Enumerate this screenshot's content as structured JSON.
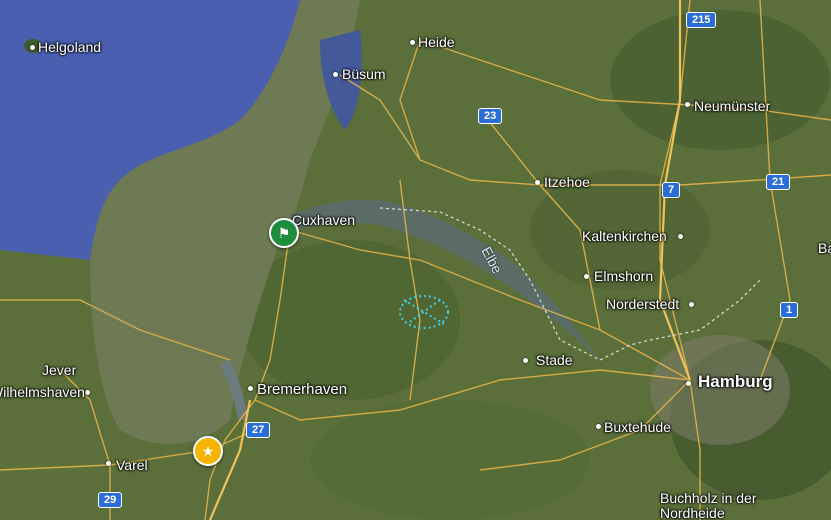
{
  "map": {
    "places": [
      {
        "id": "helgoland",
        "name": "Helgoland"
      },
      {
        "id": "heide",
        "name": "Heide"
      },
      {
        "id": "busum",
        "name": "Büsum"
      },
      {
        "id": "neumunster",
        "name": "Neumünster"
      },
      {
        "id": "itzehoe",
        "name": "Itzehoe"
      },
      {
        "id": "cuxhaven",
        "name": "Cuxhaven"
      },
      {
        "id": "kaltenkirchen",
        "name": "Kaltenkirchen"
      },
      {
        "id": "elmshorn",
        "name": "Elmshorn"
      },
      {
        "id": "norderstedt",
        "name": "Norderstedt"
      },
      {
        "id": "stade",
        "name": "Stade"
      },
      {
        "id": "hamburg",
        "name": "Hamburg"
      },
      {
        "id": "jever",
        "name": "Jever"
      },
      {
        "id": "wilhelmshaven",
        "name": "Wilhelmshaven"
      },
      {
        "id": "bremerhaven",
        "name": "Bremerhaven"
      },
      {
        "id": "buxtehude",
        "name": "Buxtehude"
      },
      {
        "id": "varel",
        "name": "Varel"
      },
      {
        "id": "buchholz",
        "name": "Buchholz in der Nordheide"
      },
      {
        "id": "ba_partial",
        "name": "Ba"
      }
    ],
    "river_label": "Elbe",
    "road_shields": [
      "215",
      "23",
      "7",
      "21",
      "1",
      "27",
      "29"
    ],
    "markers": {
      "start": {
        "icon": "flag-icon",
        "color": "#1e8e3e"
      },
      "favorite": {
        "icon": "star-icon",
        "color": "#f5b400"
      }
    },
    "colors": {
      "sea": "#4a5fae",
      "land": "#5a6e3a",
      "road": "#e0b24a",
      "highlight_area": "#3fd0e8"
    }
  }
}
